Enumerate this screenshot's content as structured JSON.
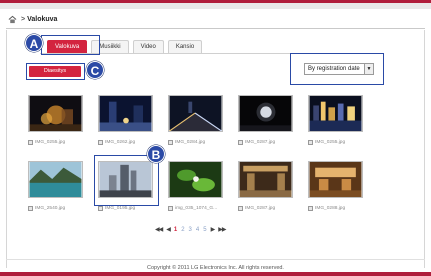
{
  "breadcrumb": {
    "separator": ">",
    "title": "Valokuva"
  },
  "tabs": [
    {
      "label": "Valokuva",
      "active": true
    },
    {
      "label": "Musiikki",
      "active": false
    },
    {
      "label": "Video",
      "active": false
    },
    {
      "label": "Kansio",
      "active": false
    }
  ],
  "toolbar": {
    "slideshow_label": "Diaesitys"
  },
  "sort": {
    "selected": "By registration date",
    "arrow": "▼"
  },
  "markers": {
    "a": "A",
    "b": "B",
    "c": "C"
  },
  "thumbnails": [
    {
      "label": "IMG_0255.jpg",
      "scene": "night-city-gold"
    },
    {
      "label": "IMG_0262.jpg",
      "scene": "night-street-blue"
    },
    {
      "label": "IMG_0284.jpg",
      "scene": "night-road-lights"
    },
    {
      "label": "IMG_0287.jpg",
      "scene": "night-moon"
    },
    {
      "label": "IMG_0255.jpg",
      "scene": "night-skyline"
    },
    {
      "label": "IMG_2540.jpg",
      "scene": "lake-mountain"
    },
    {
      "label": "IMG_0195.jpg",
      "scene": "skyscraper"
    },
    {
      "label": "img_035_1074_G...",
      "scene": "green-leaves"
    },
    {
      "label": "IMG_0287.jpg",
      "scene": "mall-interior"
    },
    {
      "label": "IMG_0288.jpg",
      "scene": "warm-interior"
    }
  ],
  "pager": {
    "first": "◀◀",
    "prev": "◀",
    "pages": [
      "1",
      "2",
      "3",
      "4",
      "5"
    ],
    "current": "1",
    "next": "▶",
    "last": "▶▶"
  },
  "footer": {
    "copyright": "Copyright © 2011 LG Electronics Inc. All rights reserved."
  },
  "colors": {
    "accent": "#d3243f",
    "marker": "#2b4aa6",
    "brand_bar": "#b01e3c"
  }
}
